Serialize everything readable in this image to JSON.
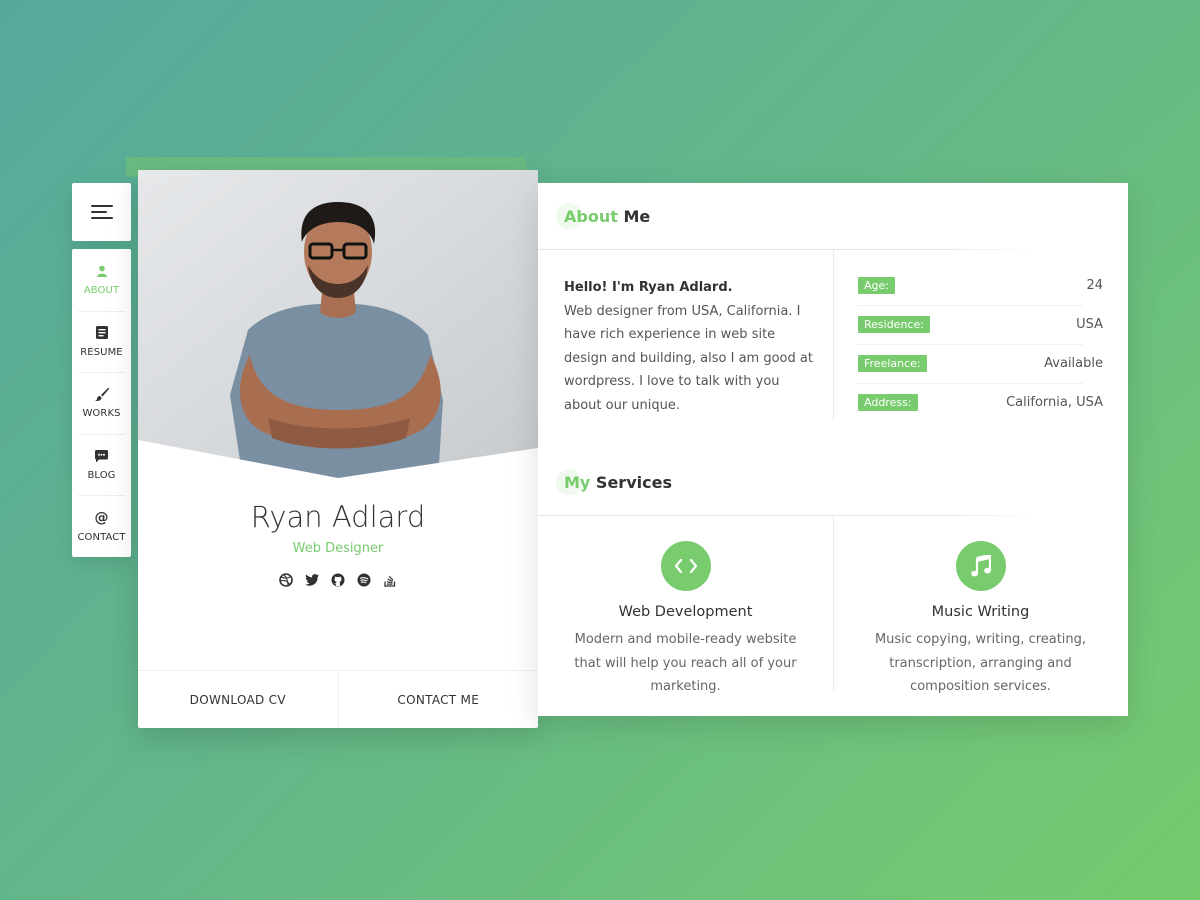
{
  "colors": {
    "accent": "#78cc6d",
    "text": "#323232"
  },
  "nav": {
    "menu_icon": "hamburger-icon",
    "items": [
      {
        "label": "ABOUT",
        "icon": "user-icon",
        "active": true
      },
      {
        "label": "RESUME",
        "icon": "document-icon",
        "active": false
      },
      {
        "label": "WORKS",
        "icon": "brush-icon",
        "active": false
      },
      {
        "label": "BLOG",
        "icon": "chat-icon",
        "active": false
      },
      {
        "label": "CONTACT",
        "icon": "at-icon",
        "active": false
      }
    ]
  },
  "profile": {
    "name": "Ryan Adlard",
    "role": "Web Designer",
    "socials": [
      "dribbble-icon",
      "twitter-icon",
      "github-icon",
      "spotify-icon",
      "stack-overflow-icon"
    ],
    "download_label": "DOWNLOAD CV",
    "contact_label": "CONTACT ME"
  },
  "about": {
    "title_accent": "About",
    "title_rest": " Me",
    "hello": "Hello! I'm Ryan Adlard.",
    "bio": "Web designer from USA, California. I have rich experience in web site design and building, also I am good at wordpress. I love to talk with you about our unique.",
    "info": [
      {
        "key": "Age:",
        "value": "24"
      },
      {
        "key": "Residence:",
        "value": "USA"
      },
      {
        "key": "Freelance:",
        "value": "Available"
      },
      {
        "key": "Address:",
        "value": "California, USA"
      }
    ]
  },
  "services": {
    "title_accent": "My",
    "title_rest": " Services",
    "items": [
      {
        "icon": "code-icon",
        "title": "Web Development",
        "desc": "Modern and mobile-ready website that will help you reach all of your marketing."
      },
      {
        "icon": "music-note-icon",
        "title": "Music Writing",
        "desc": "Music copying, writing, creating, transcription, arranging and composition services."
      }
    ]
  }
}
